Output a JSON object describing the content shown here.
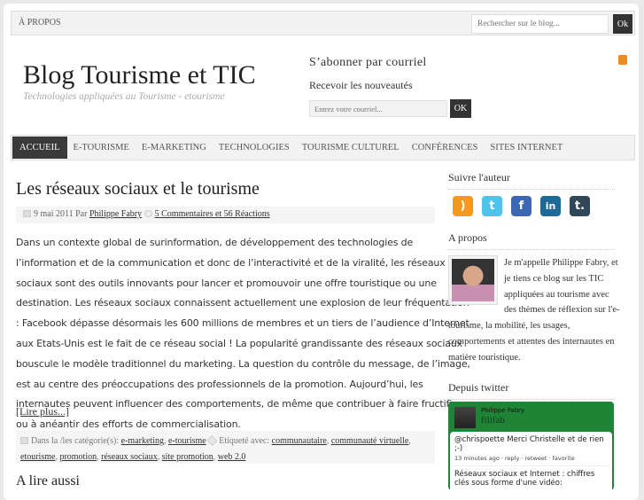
{
  "topbar": {
    "about_link": "À PROPOS",
    "search_placeholder": "Rechercher sur le blog...",
    "search_button": "Ok"
  },
  "header": {
    "title": "Blog Tourisme et TIC",
    "tagline": "Technologies appliquées au Tourisme - etourisme",
    "subscribe_heading": "S’abonner par courriel",
    "subscribe_text": "Recevoir les nouveautés",
    "email_placeholder": "Entrez votre courriel...",
    "email_button": "OK"
  },
  "nav": [
    "ACCUEIL",
    "E-TOURISME",
    "E-MARKETING",
    "TECHNOLOGIES",
    "TOURISME CULTUREL",
    "CONFÉRENCES",
    "SITES INTERNET"
  ],
  "post": {
    "title": "Les réseaux sociaux et le tourisme",
    "date": "9 mai 2011",
    "by": "Par",
    "author": "Philippe Fabry",
    "comments": "5 Commentaires et 56 Réactions",
    "lines": [
      "Dans un contexte global de surinformation, de développement des technologies de",
      "l’information et de la communication et donc de l’interactivité et de la viralité, les réseaux",
      "sociaux sont des outils innovants pour lancer et promouvoir une offre touristique ou une",
      "destination. Les réseaux sociaux connaissent actuellement une explosion de leur fréquentation",
      ": Facebook dépasse désormais les 600 millions de membres et un tiers de l’audience d’Internet",
      "aux Etats-Unis est le fait de ce réseau social ! La popularité grandissante des réseaux sociaux",
      "bouscule le modèle traditionnel du marketing. La question du contrôle du message, de l’image,",
      "est au centre des préoccupations des professionnels de la promotion. Aujourd’hui, les",
      "internautes peuvent influencer des comportements, de même que contribuer à faire fructifier",
      "ou à anéantir des efforts de commercialisation."
    ],
    "read_more": "[Lire plus...]",
    "categories_label": "Dans la /les catégorie(s):",
    "categories": [
      "e-marketing",
      "e-tourisme"
    ],
    "tags_label": "Etiqueté avec:",
    "tags": [
      "communautaire",
      "communauté virtuelle",
      "etourisme",
      "promotion",
      "réseaux sociaux",
      "site promotion",
      "web 2.0"
    ]
  },
  "also_heading": "A lire aussi",
  "sidebar": {
    "follow_heading": "Suivre l'auteur",
    "social": [
      "rss",
      "twitter",
      "facebook",
      "linkedin",
      "tumblr"
    ],
    "about_heading": "A propos",
    "about_text": "Je m'appelle Philippe Fabry, et je tiens ce blog sur les TIC appliquées au tourisme avec des thèmes de réflexion sur l'e-tourisme, la mobilité, les usages, comportements et attentes des internautes en matière touristique.",
    "twitter_heading": "Depuis twitter",
    "twitter_name": "Philippe Fabry",
    "twitter_user": "filifab",
    "tweets": [
      {
        "text": "@chrispoette Merci Christelle et de rien ;-)",
        "meta": "13 minutes ago · reply · retweet · favorite"
      },
      {
        "text": "Réseaux sociaux et Internet : chiffres clés sous forme d'une vidéo:"
      }
    ]
  }
}
